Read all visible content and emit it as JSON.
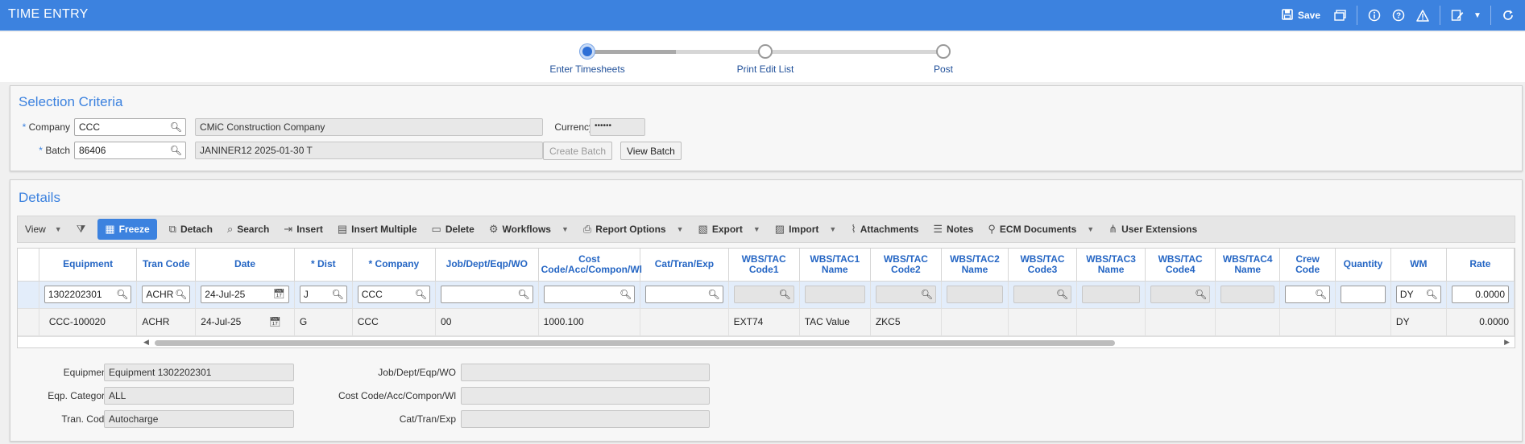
{
  "header": {
    "title": "TIME ENTRY",
    "save_label": "Save",
    "icons": [
      "save-icon",
      "window-icon",
      "info-icon",
      "help-icon",
      "warning-icon",
      "edit-icon",
      "chevron-down-icon",
      "refresh-icon"
    ]
  },
  "wizard": {
    "steps": [
      {
        "label": "Enter Timesheets",
        "active": true
      },
      {
        "label": "Print Edit List",
        "active": false
      },
      {
        "label": "Post",
        "active": false
      }
    ]
  },
  "selection": {
    "title": "Selection Criteria",
    "company_label": "Company",
    "company_value": "CCC",
    "company_name": "CMiC Construction Company",
    "currency_label": "Currency",
    "currency_value": "••••••",
    "batch_label": "Batch",
    "batch_value": "86406",
    "batch_desc": "JANINER12 2025-01-30 T",
    "create_batch_label": "Create Batch",
    "view_batch_label": "View Batch"
  },
  "details": {
    "title": "Details",
    "toolbar": {
      "view": "View",
      "freeze": "Freeze",
      "detach": "Detach",
      "search": "Search",
      "insert": "Insert",
      "insert_multiple": "Insert Multiple",
      "delete": "Delete",
      "workflows": "Workflows",
      "report_options": "Report Options",
      "export": "Export",
      "import": "Import",
      "attachments": "Attachments",
      "notes": "Notes",
      "ecm_documents": "ECM Documents",
      "user_extensions": "User Extensions"
    },
    "columns": [
      "Equipment",
      "Tran Code",
      "Date",
      "* Dist",
      "* Company",
      "Job/Dept/Eqp/WO",
      "Cost Code/Acc/Compon/Wl",
      "Cat/Tran/Exp",
      "WBS/TAC Code1",
      "WBS/TAC1 Name",
      "WBS/TAC Code2",
      "WBS/TAC2 Name",
      "WBS/TAC Code3",
      "WBS/TAC3 Name",
      "WBS/TAC Code4",
      "WBS/TAC4 Name",
      "Crew Code",
      "Quantity",
      "WM",
      "Rate"
    ],
    "edit_row": {
      "equipment": "1302202301",
      "tran_code": "ACHR",
      "date": "24-Jul-25",
      "dist": "J",
      "company": "CCC",
      "wm": "DY",
      "rate": "0.0000"
    },
    "data_row": {
      "equipment": "CCC-100020",
      "tran_code": "ACHR",
      "date": "24-Jul-25",
      "dist": "G",
      "company": "CCC",
      "job": "00",
      "cost_code": "1000.100",
      "wbs_code1": "EXT74",
      "wbs1_name": "TAC Value",
      "wbs_code2": "ZKC5",
      "wm": "DY",
      "rate": "0.0000"
    },
    "footer": {
      "equipment_label": "Equipment",
      "equipment_value": "Equipment 1302202301",
      "eqp_category_label": "Eqp. Category",
      "eqp_category_value": "ALL",
      "tran_code_label": "Tran. Code",
      "tran_code_value": "Autocharge",
      "job_label": "Job/Dept/Eqp/WO",
      "job_value": "",
      "cost_code_label": "Cost Code/Acc/Compon/Wl",
      "cost_code_value": "",
      "cat_label": "Cat/Tran/Exp",
      "cat_value": ""
    }
  },
  "colors": {
    "brand": "#3c82df",
    "header_text": "#2566c4"
  }
}
